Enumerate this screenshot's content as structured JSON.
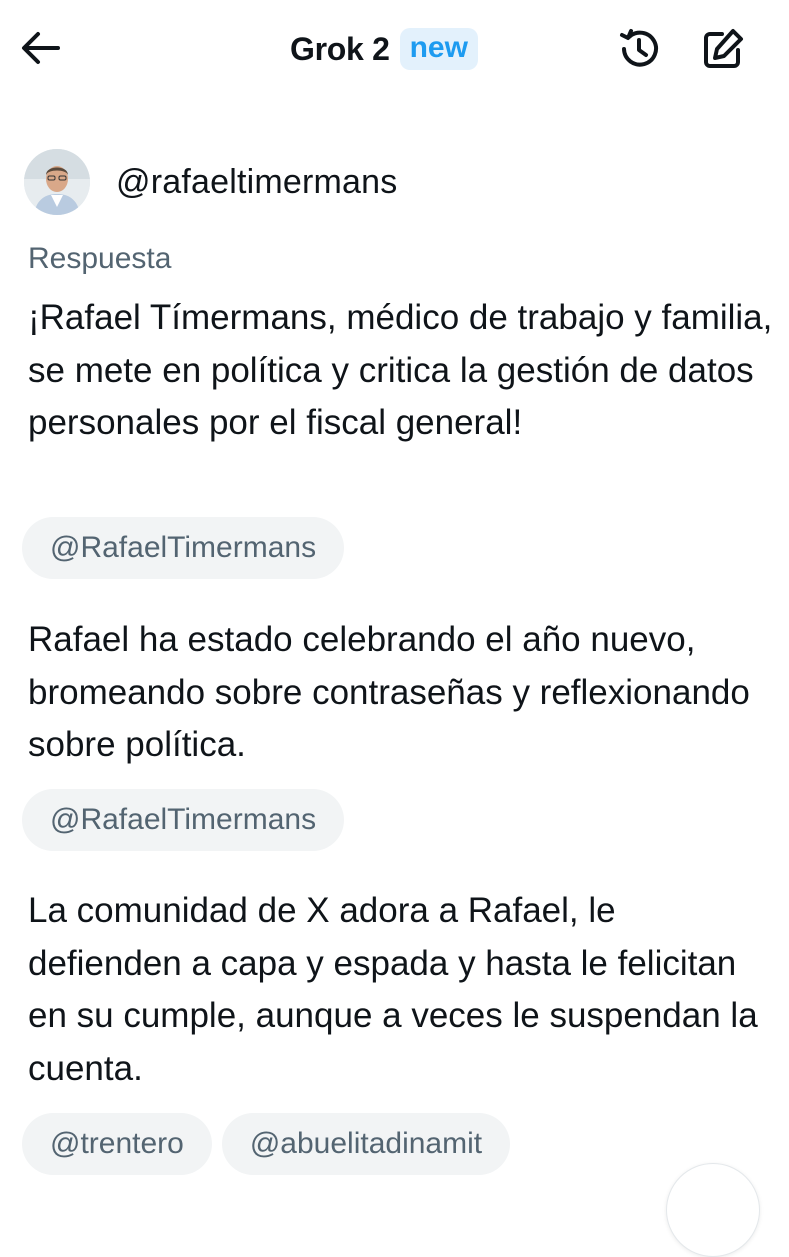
{
  "header": {
    "title": "Grok 2",
    "badge": "new",
    "back_icon": "arrow-left-icon",
    "history_icon": "history-icon",
    "edit_icon": "compose-icon"
  },
  "profile": {
    "handle": "@rafaeltimermans",
    "avatar": "avatar-photo"
  },
  "response": {
    "label": "Respuesta",
    "items": [
      {
        "text": "¡Rafael Tímermans, médico de trabajo y familia, se mete en política y critica la gestión de datos personales por el fiscal general!",
        "sources": [
          "@RafaelTimermans"
        ]
      },
      {
        "text": "Rafael ha estado celebrando el año nuevo, bromeando sobre contraseñas y reflexionando sobre política.",
        "sources": [
          "@RafaelTimermans"
        ]
      },
      {
        "text": "La comunidad de X adora a Rafael, le defienden a capa y espada y hasta le felicitan en su cumple, aunque a veces le suspendan la cuenta.",
        "sources": [
          "@trentero",
          "@abuelitadinamit"
        ]
      }
    ]
  },
  "colors": {
    "accent": "#1d9bf0",
    "badge_bg": "#e3f1fc",
    "text": "#0f1419",
    "muted": "#536471",
    "chip_bg": "#f2f4f5"
  }
}
